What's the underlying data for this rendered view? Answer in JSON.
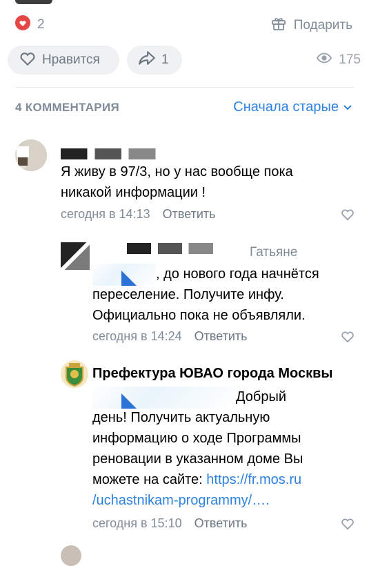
{
  "post": {
    "reactions_count": "2",
    "gift_label": "Подарить",
    "like_label": "Нравится",
    "share_count": "1",
    "views_count": "175"
  },
  "comments_header": {
    "count_label": "4 КОММЕНТАРИЯ",
    "sort_label": "Сначала старые"
  },
  "comments": [
    {
      "text_line1": "Я живу в 97/3, но у нас вообще пока",
      "text_line2": "никакой информации !",
      "time": "сегодня в 14:13",
      "reply_label": "Ответить"
    },
    {
      "reply_to": "Гатьяне",
      "text_line1": ", до нового года начнётся",
      "text_line2": "переселение. Получите инфу.",
      "text_line3": "Официально пока не объявляли.",
      "time": "сегодня в 14:24",
      "reply_label": "Ответить"
    },
    {
      "author": "Префектура ЮВАО города Москвы",
      "text_line1": "Добрый",
      "text_line2": "день! Получить актуальную",
      "text_line3": "информацию о ходе Программы",
      "text_line4": "реновации в указанном доме Вы",
      "text_line5_prefix": "можете на сайте: ",
      "link_part1": "https://fr.mos.ru",
      "link_part2": "/uchastnikam-programmy/….",
      "time": "сегодня в 15:10",
      "reply_label": "Ответить"
    }
  ],
  "icons": {
    "reaction": "heart-filled-icon",
    "gift": "gift-icon",
    "like": "heart-outline-icon",
    "share": "share-icon",
    "views": "eye-icon",
    "sort": "chevron-down-icon",
    "comment_like": "heart-outline-icon"
  },
  "colors": {
    "accent": "#2d81e0",
    "reaction_red": "#e64646",
    "secondary_text": "#818c99"
  }
}
